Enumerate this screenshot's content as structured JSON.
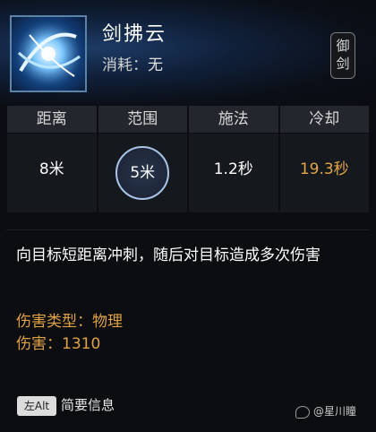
{
  "skill": {
    "name": "剑拂云",
    "cost_label": "消耗：",
    "cost_value": "无",
    "tag_line1": "御",
    "tag_line2": "剑"
  },
  "stats": {
    "range": {
      "label": "距离",
      "value": "8米"
    },
    "area": {
      "label": "范围",
      "value": "5米"
    },
    "cast": {
      "label": "施法",
      "value": "1.2秒"
    },
    "cooldown": {
      "label": "冷却",
      "value": "19.3秒"
    }
  },
  "description": {
    "text": "向目标短距离冲刺，随后对目标造成多次伤害",
    "damage_type": "伤害类型：物理",
    "damage": "伤害：1310"
  },
  "footer": {
    "key": "左Alt",
    "key_label": "简要信息",
    "watermark": "@星川瞳"
  },
  "colors": {
    "accent_orange": "#e3a54a",
    "icon_blue": "#2f7fd2",
    "circle_border": "#a9c4e6"
  }
}
